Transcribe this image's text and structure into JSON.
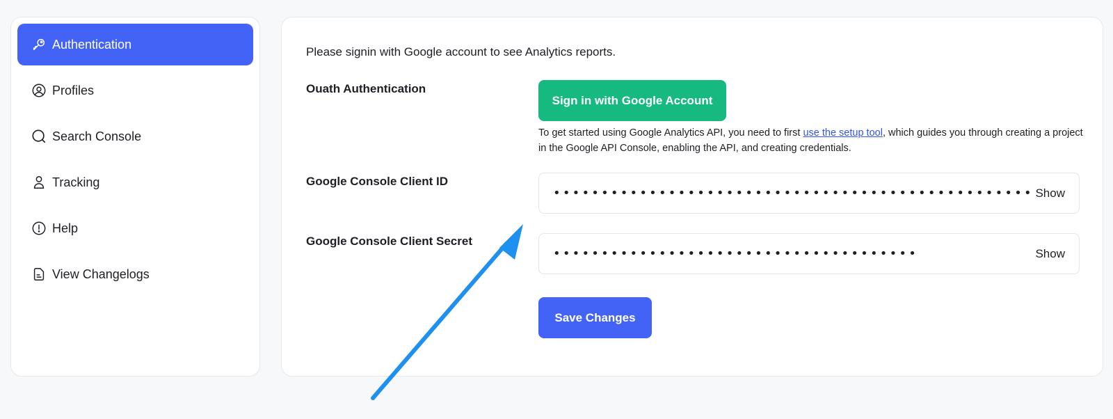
{
  "sidebar": {
    "items": [
      {
        "label": "Authentication",
        "icon": "key-icon",
        "active": true
      },
      {
        "label": "Profiles",
        "icon": "user-circle-icon"
      },
      {
        "label": "Search Console",
        "icon": "search-icon"
      },
      {
        "label": "Tracking",
        "icon": "person-icon"
      },
      {
        "label": "Help",
        "icon": "info-icon"
      },
      {
        "label": "View Changelogs",
        "icon": "document-icon"
      }
    ]
  },
  "main": {
    "intro": "Please signin with Google account to see Analytics reports.",
    "oauth": {
      "label": "Ouath Authentication",
      "button": "Sign in with Google Account",
      "help_before": "To get started using Google Analytics API, you need to first ",
      "help_link": "use the setup tool",
      "help_after": ", which guides you through creating a project in the Google API Console, enabling the API, and creating credentials."
    },
    "client_id": {
      "label": "Google Console Client ID",
      "value": "••••••••••••••••••••••••••••••••••••••••••••••••••••••••••••••••••••••••",
      "show": "Show"
    },
    "client_secret": {
      "label": "Google Console Client Secret",
      "value": "••••••••••••••••••••••••••••••••••••••",
      "show": "Show"
    },
    "save_button": "Save Changes"
  },
  "colors": {
    "accent": "#4263f5",
    "google_button": "#16b97f",
    "arrow": "#1e90f0"
  }
}
